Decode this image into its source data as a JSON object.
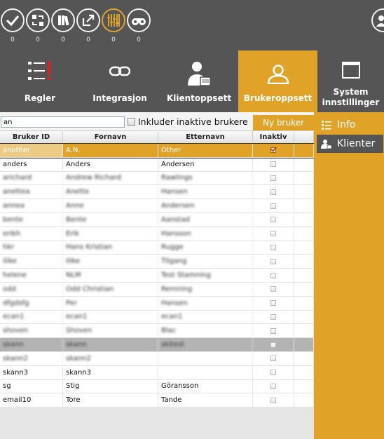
{
  "toolbar": {
    "counts": [
      "0",
      "0",
      "0",
      "0",
      "0"
    ]
  },
  "tabs": [
    {
      "label": "Regler"
    },
    {
      "label": "Integrasjon"
    },
    {
      "label": "Klientoppsett"
    },
    {
      "label": "Brukeroppsett"
    },
    {
      "label_line1": "System",
      "label_line2": "innstillinger"
    }
  ],
  "controls": {
    "search_value": "an",
    "include_inactive_label": "Inkluder inaktive brukere",
    "new_user_label": "Ny bruker"
  },
  "table": {
    "headers": [
      "Bruker ID",
      "Fornavn",
      "Etternavn",
      "Inaktiv"
    ],
    "rows": [
      [
        "another",
        "A.N.",
        "Other"
      ],
      [
        "anders",
        "Anders",
        "Andersen"
      ],
      [
        "arichard",
        "Andrew Richard",
        "Rawlings"
      ],
      [
        "anettea",
        "Anette",
        "Hansen"
      ],
      [
        "annea",
        "Anne",
        "Andersen"
      ],
      [
        "bente",
        "Bente",
        "Aanstad"
      ],
      [
        "erikh",
        "Erik",
        "Hansson"
      ],
      [
        "hkr",
        "Hans Kristian",
        "Rugge"
      ],
      [
        "ilike",
        "Ilike",
        "Tilgang"
      ],
      [
        "helene",
        "NLM",
        "Test Stamning"
      ],
      [
        "odd",
        "Odd Christian",
        "Remning"
      ],
      [
        "dfgdsfg",
        "Per",
        "Hansen"
      ],
      [
        "ecan1",
        "ecan1",
        "ecan1"
      ],
      [
        "shoven",
        "Shoven",
        "Blac"
      ],
      [
        "skann",
        "skann",
        "skitest"
      ],
      [
        "skann2",
        "skann2",
        ""
      ],
      [
        "skann3",
        "skann3",
        ""
      ],
      [
        "sg",
        "Stig",
        "Göransson"
      ],
      [
        "email10",
        "Tore",
        "Tande"
      ]
    ]
  },
  "side": {
    "info_label": "Info",
    "clients_label": "Klienter"
  },
  "colors": {
    "accent": "#e0a328",
    "dark": "#555555"
  }
}
